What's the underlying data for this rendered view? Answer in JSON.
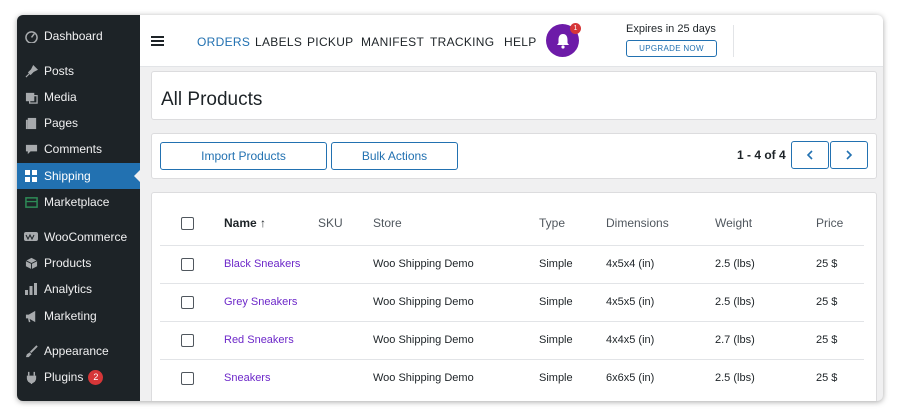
{
  "sidebar": {
    "items": [
      {
        "label": "Dashboard",
        "icon": "dashboard-icon"
      },
      {
        "label": "Posts",
        "icon": "pin-icon"
      },
      {
        "label": "Media",
        "icon": "media-icon"
      },
      {
        "label": "Pages",
        "icon": "pages-icon"
      },
      {
        "label": "Comments",
        "icon": "comment-icon"
      },
      {
        "label": "Shipping",
        "icon": "grid-icon",
        "active": true
      },
      {
        "label": "Marketplace",
        "icon": "store-icon"
      },
      {
        "label": "WooCommerce",
        "icon": "woo-icon"
      },
      {
        "label": "Products",
        "icon": "box-icon"
      },
      {
        "label": "Analytics",
        "icon": "bar-chart-icon"
      },
      {
        "label": "Marketing",
        "icon": "megaphone-icon"
      },
      {
        "label": "Appearance",
        "icon": "brush-icon"
      },
      {
        "label": "Plugins",
        "icon": "plug-icon",
        "badge": "2"
      }
    ]
  },
  "topnav": {
    "links": [
      "ORDERS",
      "LABELS",
      "PICKUP",
      "MANIFEST",
      "TRACKING",
      "HELP"
    ],
    "active": "ORDERS",
    "notification_count": "1",
    "expires_text": "Expires in 25 days",
    "upgrade_label": "UPGRADE NOW"
  },
  "page": {
    "title": "All Products",
    "import_label": "Import Products",
    "bulk_label": "Bulk Actions",
    "pagination": "1 - 4 of 4"
  },
  "table": {
    "headers": [
      "Name ↑",
      "SKU",
      "Store",
      "Type",
      "Dimensions",
      "Weight",
      "Price"
    ],
    "rows": [
      {
        "name": "Black Sneakers",
        "sku": "",
        "store": "Woo Shipping Demo",
        "type": "Simple",
        "dimensions": "4x5x4 (in)",
        "weight": "2.5 (lbs)",
        "price": "25 $"
      },
      {
        "name": "Grey Sneakers",
        "sku": "",
        "store": "Woo Shipping Demo",
        "type": "Simple",
        "dimensions": "4x5x5 (in)",
        "weight": "2.5 (lbs)",
        "price": "25 $"
      },
      {
        "name": "Red Sneakers",
        "sku": "",
        "store": "Woo Shipping Demo",
        "type": "Simple",
        "dimensions": "4x4x5 (in)",
        "weight": "2.7 (lbs)",
        "price": "25 $"
      },
      {
        "name": "Sneakers",
        "sku": "",
        "store": "Woo Shipping Demo",
        "type": "Simple",
        "dimensions": "6x6x5 (in)",
        "weight": "2.5 (lbs)",
        "price": "25 $"
      }
    ]
  },
  "colors": {
    "sidebar_bg": "#1d2327",
    "active_blue": "#2271b1",
    "link_purple": "#6d28c9",
    "bell_purple": "#6d1ba8",
    "badge_red": "#d63638"
  }
}
